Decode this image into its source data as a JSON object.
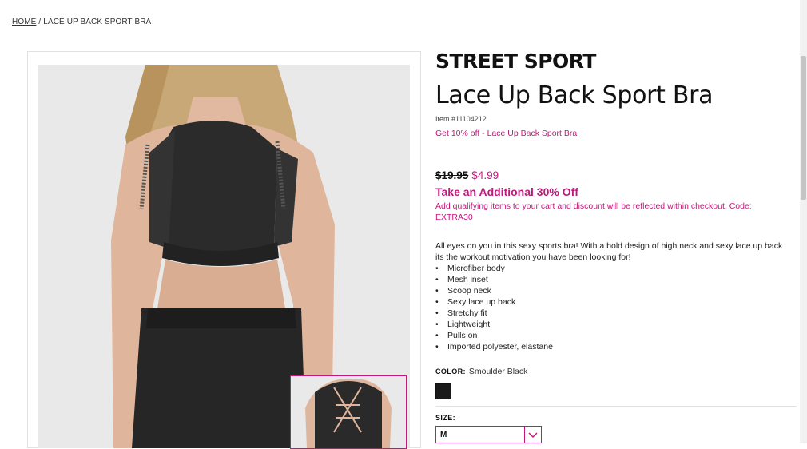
{
  "breadcrumb": {
    "home": "HOME",
    "separator": "/",
    "current": "LACE UP BACK SPORT BRA"
  },
  "product": {
    "brand": "STREET SPORT",
    "title": "Lace Up Back Sport Bra",
    "item_number": "Item #11104212",
    "promo_link": "Get 10% off - Lace Up Back Sport Bra",
    "price_original": "$19.95",
    "price_sale": "$4.99",
    "offer_title": "Take an Additional 30% Off",
    "offer_note": "Add qualifying items to your cart and discount will be reflected within checkout. Code: EXTRA30",
    "description": "All eyes on you in this sexy sports bra! With a bold design of high neck and sexy lace up back its the workout motivation you have been looking for!",
    "features": [
      "Microfiber body",
      "Mesh inset",
      "Scoop neck",
      "Sexy lace up back",
      "Stretchy fit",
      "Lightweight",
      "Pulls on",
      "Imported polyester, elastane"
    ],
    "color_label": "COLOR:",
    "color_value": "Smoulder Black",
    "size_label": "SIZE:",
    "size_value": "M"
  },
  "colors": {
    "accent": "#c2187b",
    "swatch": "#1a1a1a",
    "image_bg": "#e9e9e9"
  },
  "icons": {
    "dropdown": "chevron-down-icon"
  }
}
